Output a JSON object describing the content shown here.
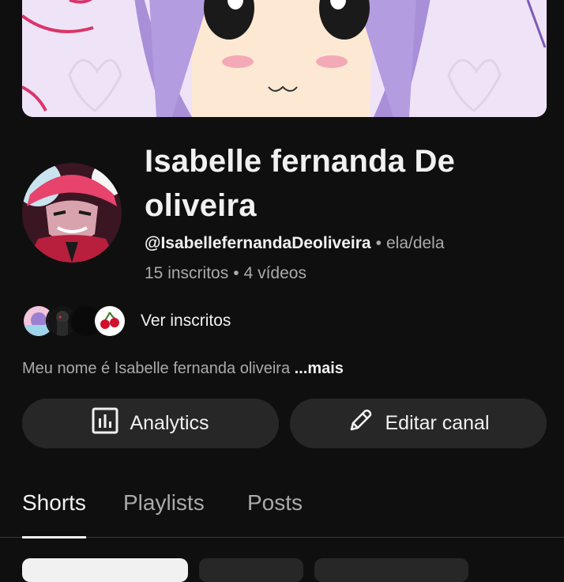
{
  "channel": {
    "name": "Isabelle fernanda De oliveira",
    "handle": "@IsabellefernandaDeoliveira",
    "pronouns": "ela/dela",
    "subscribers": "15 inscritos",
    "videos": "4 vídeos",
    "separator": "•"
  },
  "subscribers_preview": {
    "label": "Ver inscritos"
  },
  "description": {
    "text": "Meu nome é Isabelle fernanda oliveira",
    "more": "...mais"
  },
  "actions": {
    "analytics": "Analytics",
    "edit": "Editar canal"
  },
  "tabs": [
    {
      "label": "Shorts",
      "active": true
    },
    {
      "label": "Playlists",
      "active": false
    },
    {
      "label": "Posts",
      "active": false
    }
  ],
  "colors": {
    "background": "#0f0f0f",
    "button_bg": "#272727",
    "secondary_text": "#aaaaaa",
    "primary_text": "#f1f1f1"
  },
  "icons": [
    "analytics-icon",
    "pencil-icon"
  ]
}
